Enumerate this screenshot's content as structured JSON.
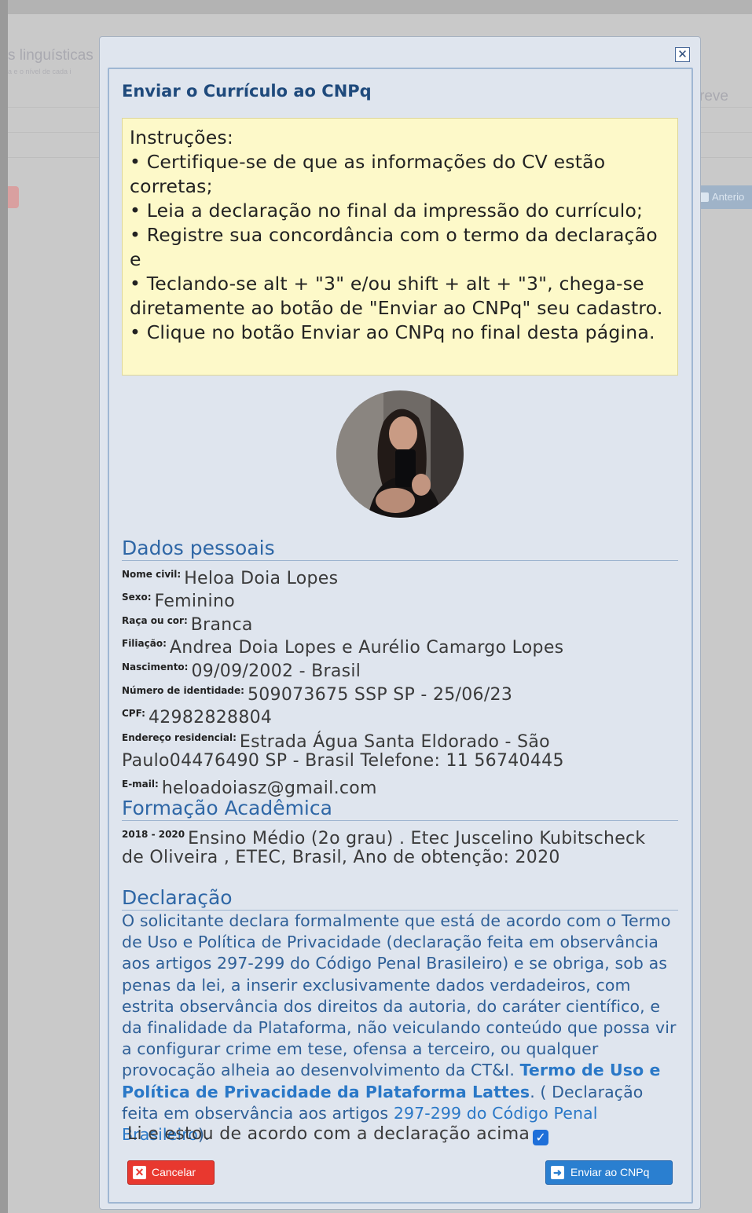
{
  "background": {
    "text_linguisticas": "s linguísticas",
    "text_small": "a e o nível de cada i",
    "text_breve": "reve",
    "anterior_label": "Anterio"
  },
  "modal": {
    "close_symbol": "✕",
    "title": "Enviar o Currículo ao CNPq",
    "instructions": [
      "Instruções:",
      "• Certifique-se de que as informações do CV estão corretas;",
      "• Leia a declaração no final da impressão do currículo;",
      "• Registre sua concordância com o termo da declaração e",
      "• Teclando-se alt + \"3\" e/ou shift + alt + \"3\", chega-se diretamente ao botão de \"Enviar ao CNPq\" seu cadastro.",
      "• Clique no botão Enviar ao CNPq no final desta página."
    ],
    "personal": {
      "section_title": "Dados pessoais",
      "nome_label": "Nome civil:",
      "nome": "Heloa Doia Lopes",
      "sexo_label": "Sexo:",
      "sexo": "Feminino",
      "raca_label": "Raça ou cor:",
      "raca": "Branca",
      "filiacao_label": "Filiação:",
      "filiacao": "Andrea Doia Lopes e Aurélio Camargo Lopes",
      "nascimento_label": "Nascimento:",
      "nascimento": "09/09/2002 - Brasil",
      "identidade_label": "Número de identidade:",
      "identidade": "509073675 SSP SP - 25/06/23",
      "cpf_label": "CPF:",
      "cpf": "42982828804",
      "endereco_label": "Endereço residencial:",
      "endereco_line1": "Estrada Água Santa Eldorado - São",
      "endereco_line2": "Paulo04476490 SP - Brasil Telefone: 11 56740445",
      "email_label": "E-mail:",
      "email": "heloadoiasz@gmail.com"
    },
    "formacao": {
      "section_title": "Formação Acadêmica",
      "period": "2018 - 2020",
      "line1": "Ensino Médio (2o grau) . Etec Juscelino Kubitscheck",
      "line2": "de Oliveira , ETEC, Brasil, Ano de obtenção: 2020"
    },
    "declaracao": {
      "section_title": "Declaração",
      "text": "O solicitante declara formalmente que está de acordo com o Termo de Uso e Política de Privacidade (declaração feita em observância aos artigos 297-299 do Código Penal Brasileiro) e se obriga, sob as penas da lei, a inserir exclusivamente dados verdadeiros, com estrita observância dos direitos da autoria, do caráter científico, e da finalidade da Plataforma, não veiculando conteúdo que possa vir a configurar crime em tese, ofensa a terceiro, ou qualquer provocação alheia ao desenvolvimento da CT&I. ",
      "termo_link": "Termo de Uso e Política de Privacidade da Plataforma Lattes",
      "after_link": ". ( Declaração feita em observância aos artigos ",
      "codigo_link": "297-299 do Código Penal Brasileiro",
      "closing": ").",
      "agree_label": "Li e estou de acordo com a declaração acima",
      "agree_checked": true
    },
    "buttons": {
      "cancel": "Cancelar",
      "send": "Enviar ao CNPq"
    }
  }
}
